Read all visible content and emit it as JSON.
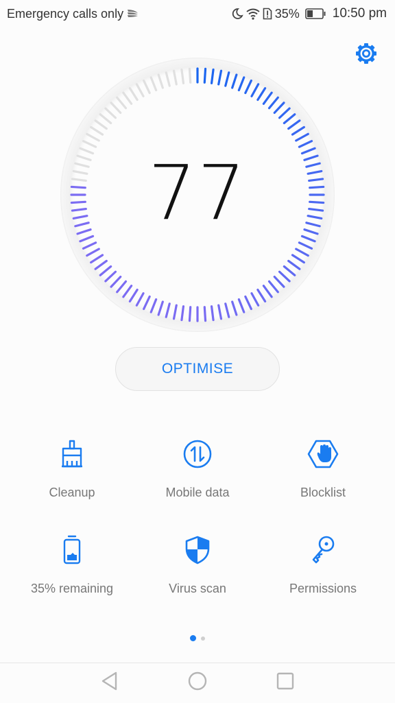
{
  "status_bar": {
    "carrier_text": "Emergency calls only",
    "battery_percent": "35%",
    "time": "10:50 pm",
    "icons": [
      "swiftkey-icon",
      "moon-icon",
      "wifi-icon",
      "sim-alert-icon",
      "battery-icon"
    ]
  },
  "header": {
    "settings_icon": "gear-icon"
  },
  "gauge": {
    "score": "77",
    "max": 100,
    "fill_fraction": 0.77,
    "colors": {
      "start": "#1a66f0",
      "end": "#7b6cf2",
      "inactive": "#e0e0e0"
    }
  },
  "optimise_button": {
    "label": "OPTIMISE"
  },
  "tools": [
    {
      "label": "Cleanup",
      "icon": "brush-icon"
    },
    {
      "label": "Mobile data",
      "icon": "data-transfer-icon"
    },
    {
      "label": "Blocklist",
      "icon": "hand-stop-icon"
    },
    {
      "label": "35% remaining",
      "icon": "battery-icon"
    },
    {
      "label": "Virus scan",
      "icon": "shield-icon"
    },
    {
      "label": "Permissions",
      "icon": "key-icon"
    }
  ],
  "pager": {
    "pages": 2,
    "current": 1
  },
  "navbar": {
    "buttons": [
      "back-icon",
      "home-icon",
      "recents-icon"
    ]
  },
  "colors": {
    "accent": "#1a7cf0",
    "label": "#777777"
  }
}
